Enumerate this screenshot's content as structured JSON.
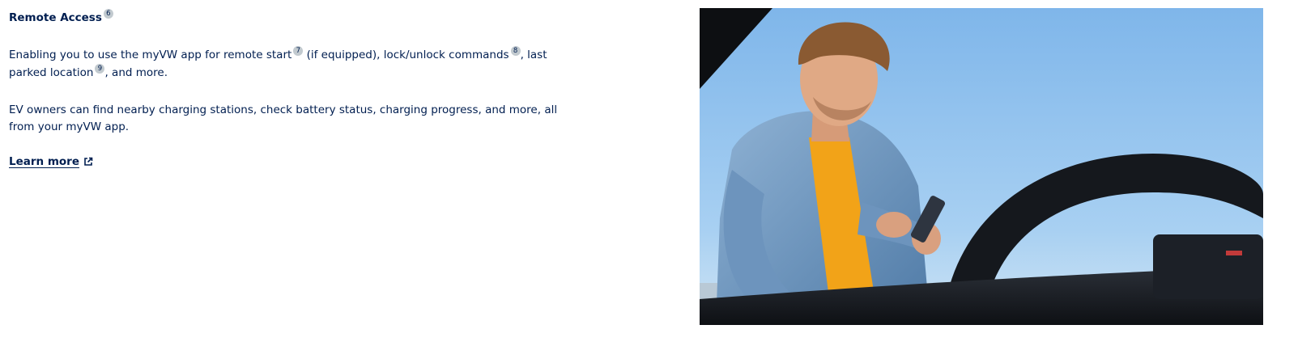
{
  "section": {
    "title": "Remote Access",
    "title_footnote": "6",
    "paragraph1": {
      "part1": "Enabling you to use the myVW app for remote start",
      "footnote1": "7",
      "part2": " (if equipped), lock/unlock commands",
      "footnote2": "8",
      "part3": ", last parked location",
      "footnote3": "9",
      "part4": ", and more."
    },
    "paragraph2": "EV owners can find nearby charging stations, check battery status, charging progress, and more, all from your myVW app.",
    "learn_more": "Learn more",
    "learn_more_icon": "external-link-icon"
  },
  "image": {
    "subject": "photo-man-with-phone-by-car"
  },
  "colors": {
    "text": "#001e50",
    "footnote_bg": "#c2cacf"
  }
}
